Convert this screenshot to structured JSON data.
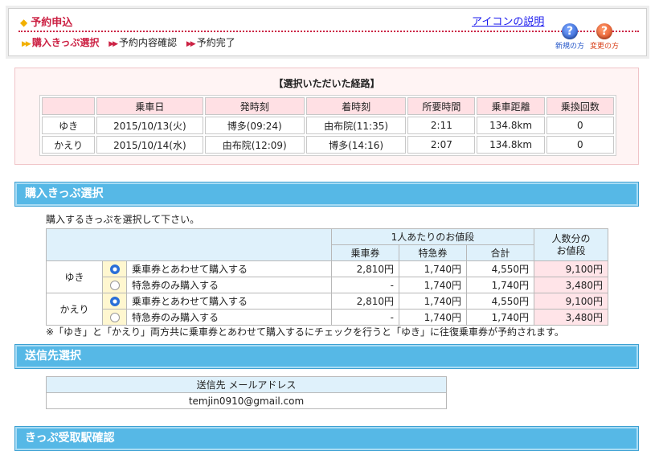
{
  "header": {
    "title": "予約申込",
    "icon_help_link": "アイコンの説明",
    "steps": [
      "購入きっぷ選択",
      "予約内容確認",
      "予約完了"
    ],
    "help_new_label": "新規の方",
    "help_change_label": "変更の方",
    "help_glyph": "?"
  },
  "route": {
    "title": "【選択いただいた経路】",
    "columns": [
      "",
      "乗車日",
      "発時刻",
      "着時刻",
      "所要時間",
      "乗車距離",
      "乗換回数"
    ],
    "rows": [
      [
        "ゆき",
        "2015/10/13(火)",
        "博多(09:24)",
        "由布院(11:35)",
        "2:11",
        "134.8km",
        "0"
      ],
      [
        "かえり",
        "2015/10/14(水)",
        "由布院(12:09)",
        "博多(14:16)",
        "2:07",
        "134.8km",
        "0"
      ]
    ]
  },
  "ticket_section": {
    "title": "購入きっぷ選択",
    "instruction": "購入するきっぷを選択して下さい。",
    "per_person_header": "1人あたりのお値段",
    "total_header": "人数分の\nお値段",
    "sub_headers": [
      "乗車券",
      "特急券",
      "合計"
    ],
    "rows": [
      {
        "direction": "ゆき",
        "option": "乗車券とあわせて購入する",
        "selected": true,
        "fare": "2,810円",
        "express": "1,740円",
        "sum": "4,550円",
        "total": "9,100円"
      },
      {
        "direction": "",
        "option": "特急券のみ購入する",
        "selected": false,
        "fare": "-",
        "express": "1,740円",
        "sum": "1,740円",
        "total": "3,480円"
      },
      {
        "direction": "かえり",
        "option": "乗車券とあわせて購入する",
        "selected": true,
        "fare": "2,810円",
        "express": "1,740円",
        "sum": "4,550円",
        "total": "9,100円"
      },
      {
        "direction": "",
        "option": "特急券のみ購入する",
        "selected": false,
        "fare": "-",
        "express": "1,740円",
        "sum": "1,740円",
        "total": "3,480円"
      }
    ],
    "note": "※「ゆき」と「かえり」両方共に乗車券とあわせて購入するにチェックを行うと「ゆき」に往復乗車券が予約されます。"
  },
  "mail_section": {
    "title": "送信先選択",
    "header": "送信先 メールアドレス",
    "email": "temjin0910@gmail.com"
  },
  "pickup_section": {
    "title": "きっぷ受取駅確認"
  }
}
